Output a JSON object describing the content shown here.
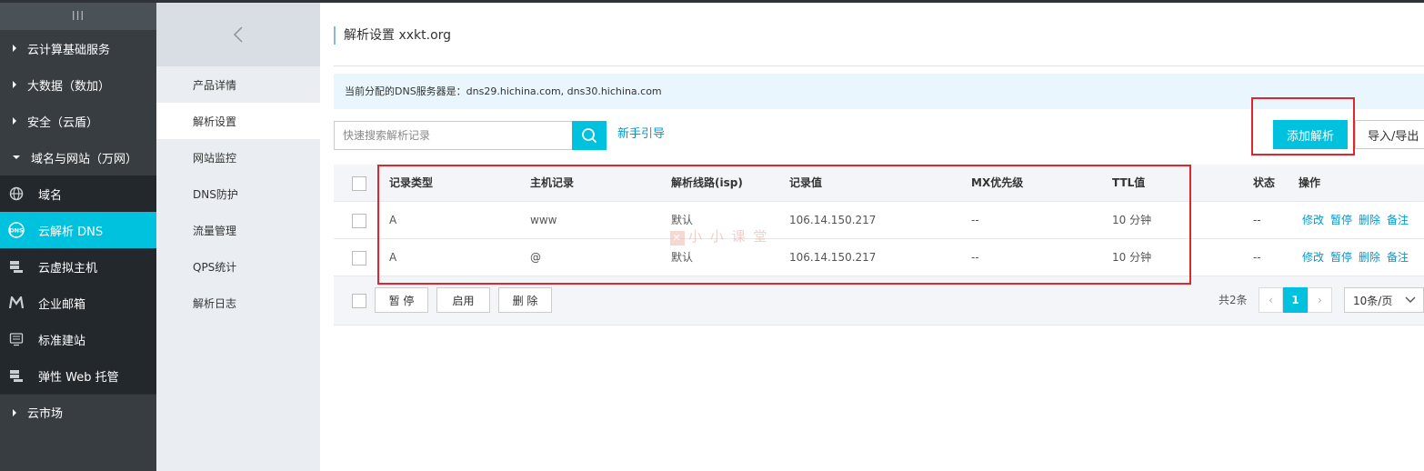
{
  "sidebar": {
    "toggle_label": "III",
    "groups": [
      {
        "label": "云计算基础服务"
      },
      {
        "label": "大数据（数加）"
      },
      {
        "label": "安全（云盾）"
      },
      {
        "label": "域名与网站（万网）"
      }
    ],
    "items": [
      {
        "label": "域名",
        "icon": "globe-icon"
      },
      {
        "label": "云解析 DNS",
        "icon": "dns-icon"
      },
      {
        "label": "云虚拟主机",
        "icon": "server-icon"
      },
      {
        "label": "企业邮箱",
        "icon": "mail-m-icon"
      },
      {
        "label": "标准建站",
        "icon": "monitor-icon"
      },
      {
        "label": "弹性 Web 托管",
        "icon": "server-icon"
      }
    ],
    "market": {
      "label": "云市场"
    }
  },
  "subnav": {
    "items": [
      "产品详情",
      "解析设置",
      "网站监控",
      "DNS防护",
      "流量管理",
      "QPS统计",
      "解析日志"
    ]
  },
  "main": {
    "title": "解析设置 xxkt.org",
    "notice": "当前分配的DNS服务器是：dns29.hichina.com, dns30.hichina.com",
    "search_placeholder": "快速搜索解析记录",
    "guide_link": "新手引导",
    "add_button": "添加解析",
    "import_export_button": "导入/导出"
  },
  "table": {
    "headers": {
      "type": "记录类型",
      "host": "主机记录",
      "line": "解析线路(isp)",
      "value": "记录值",
      "mx": "MX优先级",
      "ttl": "TTL值",
      "status": "状态",
      "ops": "操作"
    },
    "rows": [
      {
        "type": "A",
        "host": "www",
        "line": "默认",
        "value": "106.14.150.217",
        "mx": "--",
        "ttl": "10 分钟",
        "status": "--",
        "ops": [
          "修改",
          "暂停",
          "删除",
          "备注"
        ]
      },
      {
        "type": "A",
        "host": "@",
        "line": "默认",
        "value": "106.14.150.217",
        "mx": "--",
        "ttl": "10 分钟",
        "status": "--",
        "ops": [
          "修改",
          "暂停",
          "删除",
          "备注"
        ]
      }
    ],
    "footer": {
      "pause": "暂 停",
      "enable": "启用",
      "delete": "删 除",
      "total": "共2条",
      "prev": "‹",
      "current_page": "1",
      "next": "›",
      "page_size": "10条/页"
    }
  },
  "watermark": "小 小 课 堂",
  "colors": {
    "accent": "#00c1de",
    "sidebar": "#373d41",
    "highlight": "#e0262d",
    "link": "#0099cc"
  }
}
